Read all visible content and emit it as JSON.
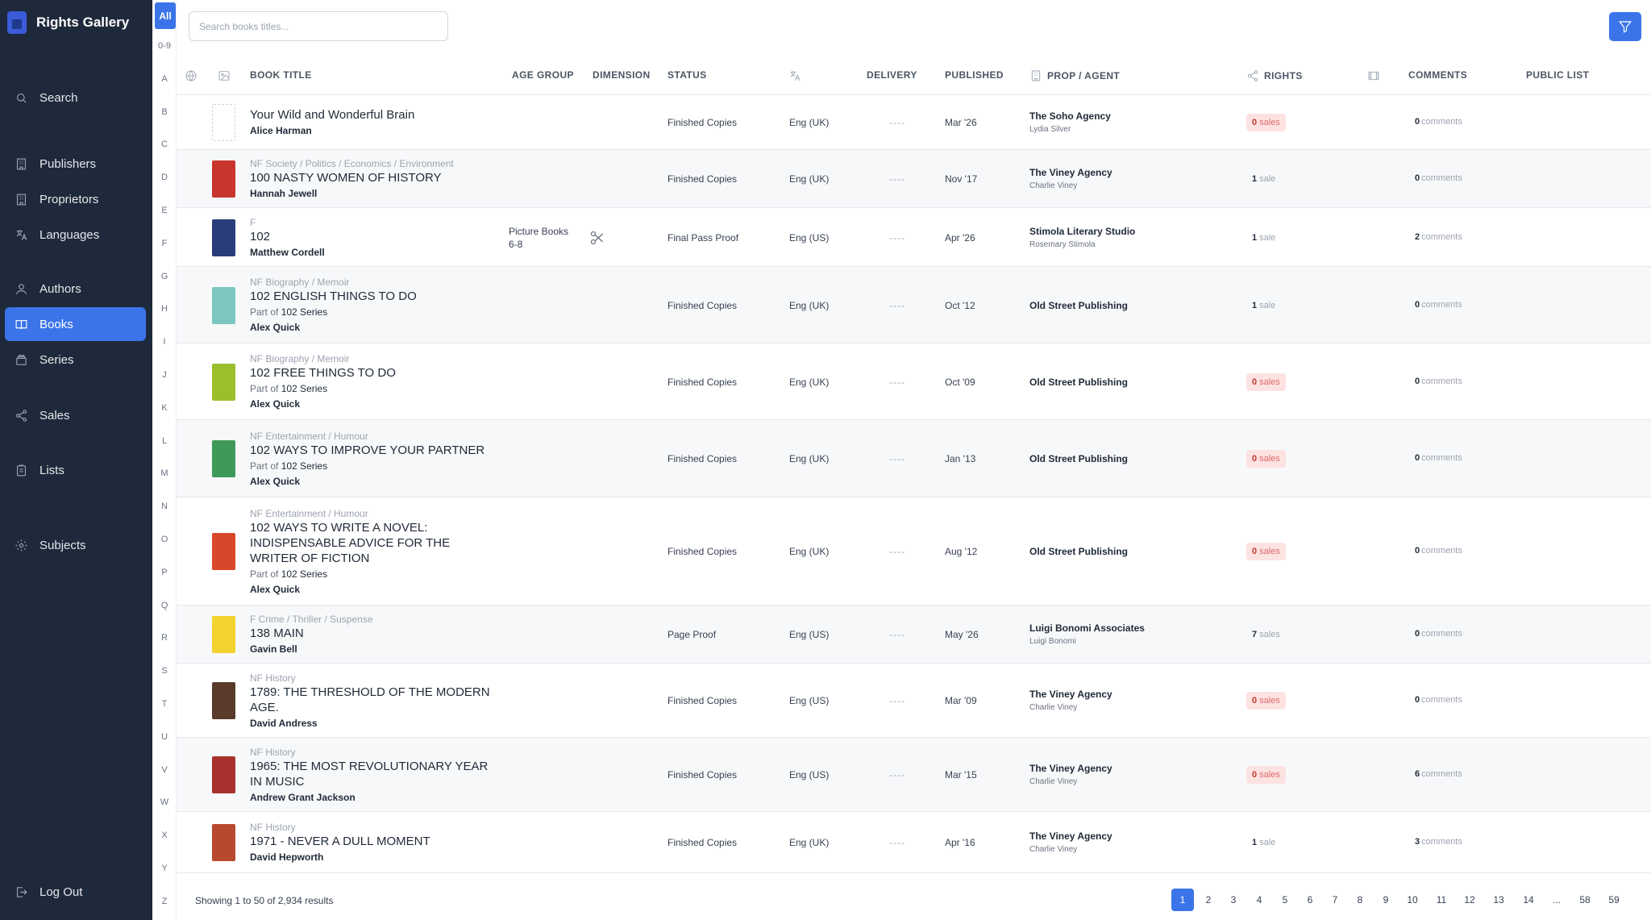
{
  "brand": {
    "name": "Rights Gallery"
  },
  "nav": [
    {
      "label": "Search",
      "icon": "search-icon",
      "key": "search"
    },
    {
      "label": "Publishers",
      "icon": "building-icon",
      "key": "publishers"
    },
    {
      "label": "Proprietors",
      "icon": "building-icon",
      "key": "proprietors"
    },
    {
      "label": "Languages",
      "icon": "translate-icon",
      "key": "languages"
    },
    {
      "label": "Authors",
      "icon": "user-icon",
      "key": "authors"
    },
    {
      "label": "Books",
      "icon": "book-open-icon",
      "key": "books",
      "active": true
    },
    {
      "label": "Series",
      "icon": "stack-icon",
      "key": "series"
    },
    {
      "label": "Sales",
      "icon": "share-icon",
      "key": "sales"
    },
    {
      "label": "Lists",
      "icon": "clipboard-icon",
      "key": "lists"
    },
    {
      "label": "Subjects",
      "icon": "gear-icon",
      "key": "subjects"
    },
    {
      "label": "Log Out",
      "icon": "logout-icon",
      "key": "logout"
    }
  ],
  "alphabet": {
    "all": "All",
    "items": [
      "0-9",
      "A",
      "B",
      "C",
      "D",
      "E",
      "F",
      "G",
      "H",
      "I",
      "J",
      "K",
      "L",
      "M",
      "N",
      "O",
      "P",
      "Q",
      "R",
      "S",
      "T",
      "U",
      "V",
      "W",
      "X",
      "Y",
      "Z"
    ]
  },
  "search": {
    "placeholder": "Search books titles..."
  },
  "columns": {
    "title": "BOOK TITLE",
    "age": "AGE GROUP",
    "dimension": "DIMENSION",
    "status": "STATUS",
    "delivery": "DELIVERY",
    "published": "PUBLISHED",
    "agent": "PROP / AGENT",
    "rights": "RIGHTS",
    "comments": "COMMENTS",
    "public_list": "PUBLIC LIST"
  },
  "series_prefix": "Part of",
  "rows": [
    {
      "category": "",
      "title": "Your Wild and Wonderful Brain",
      "series": "",
      "author": "Alice Harman",
      "age": "",
      "dimension": "",
      "status": "Finished Copies",
      "language": "Eng (UK)",
      "delivery": "----",
      "published": "Mar '26",
      "agent": "The Soho Agency",
      "agent_person": "Lydia Silver",
      "rights_count": "0",
      "rights_label": "sales",
      "comments_count": "0",
      "comments_label": "comments",
      "cover": "none"
    },
    {
      "category": "NF Society / Politics / Economics / Environment",
      "title": "100 NASTY WOMEN OF HISTORY",
      "series": "",
      "author": "Hannah Jewell",
      "age": "",
      "dimension": "",
      "status": "Finished Copies",
      "language": "Eng (UK)",
      "delivery": "----",
      "published": "Nov '17",
      "agent": "The Viney Agency",
      "agent_person": "Charlie Viney",
      "rights_count": "1",
      "rights_label": "sale",
      "comments_count": "0",
      "comments_label": "comments",
      "cover": "#c8352e"
    },
    {
      "category": "F",
      "title": "102",
      "series": "",
      "author": "Matthew Cordell",
      "age": "Picture Books 6-8",
      "dimension": "scissors-icon",
      "status": "Final Pass Proof",
      "language": "Eng (US)",
      "delivery": "----",
      "published": "Apr '26",
      "agent": "Stimola Literary Studio",
      "agent_person": "Rosemary Stimola",
      "rights_count": "1",
      "rights_label": "sale",
      "comments_count": "2",
      "comments_label": "comments",
      "cover": "#2a3d7a"
    },
    {
      "category": "NF Biography / Memoir",
      "title": "102 ENGLISH THINGS TO DO",
      "series": "102 Series",
      "author": "Alex Quick",
      "age": "",
      "dimension": "",
      "status": "Finished Copies",
      "language": "Eng (UK)",
      "delivery": "----",
      "published": "Oct '12",
      "agent": "Old Street Publishing",
      "agent_person": "",
      "rights_count": "1",
      "rights_label": "sale",
      "comments_count": "0",
      "comments_label": "comments",
      "cover": "#7cc7c0"
    },
    {
      "category": "NF Biography / Memoir",
      "title": "102 FREE THINGS TO DO",
      "series": "102 Series",
      "author": "Alex Quick",
      "age": "",
      "dimension": "",
      "status": "Finished Copies",
      "language": "Eng (UK)",
      "delivery": "----",
      "published": "Oct '09",
      "agent": "Old Street Publishing",
      "agent_person": "",
      "rights_count": "0",
      "rights_label": "sales",
      "comments_count": "0",
      "comments_label": "comments",
      "cover": "#9bbf2c"
    },
    {
      "category": "NF Entertainment / Humour",
      "title": "102 WAYS TO IMPROVE YOUR PARTNER",
      "series": "102 Series",
      "author": "Alex Quick",
      "age": "",
      "dimension": "",
      "status": "Finished Copies",
      "language": "Eng (UK)",
      "delivery": "----",
      "published": "Jan '13",
      "agent": "Old Street Publishing",
      "agent_person": "",
      "rights_count": "0",
      "rights_label": "sales",
      "comments_count": "0",
      "comments_label": "comments",
      "cover": "#3f9a5a"
    },
    {
      "category": "NF Entertainment / Humour",
      "title": "102 WAYS TO WRITE A NOVEL: INDISPENSABLE ADVICE FOR THE WRITER OF FICTION",
      "series": "102 Series",
      "author": "Alex Quick",
      "age": "",
      "dimension": "",
      "status": "Finished Copies",
      "language": "Eng (UK)",
      "delivery": "----",
      "published": "Aug '12",
      "agent": "Old Street Publishing",
      "agent_person": "",
      "rights_count": "0",
      "rights_label": "sales",
      "comments_count": "0",
      "comments_label": "comments",
      "cover": "#d9472b"
    },
    {
      "category": "F Crime / Thriller / Suspense",
      "title": "138 MAIN",
      "series": "",
      "author": "Gavin Bell",
      "age": "",
      "dimension": "",
      "status": "Page Proof",
      "language": "Eng (US)",
      "delivery": "----",
      "published": "May '26",
      "agent": "Luigi Bonomi Associates",
      "agent_person": "Luigi Bonomi",
      "rights_count": "7",
      "rights_label": "sales",
      "comments_count": "0",
      "comments_label": "comments",
      "cover": "#f2d22e"
    },
    {
      "category": "NF History",
      "title": "1789: THE THRESHOLD OF THE MODERN AGE.",
      "series": "",
      "author": "David Andress",
      "age": "",
      "dimension": "",
      "status": "Finished Copies",
      "language": "Eng (US)",
      "delivery": "----",
      "published": "Mar '09",
      "agent": "The Viney Agency",
      "agent_person": "Charlie Viney",
      "rights_count": "0",
      "rights_label": "sales",
      "comments_count": "0",
      "comments_label": "comments",
      "cover": "#5a3a2a"
    },
    {
      "category": "NF History",
      "title": "1965: THE MOST REVOLUTIONARY YEAR IN MUSIC",
      "series": "",
      "author": "Andrew Grant Jackson",
      "age": "",
      "dimension": "",
      "status": "Finished Copies",
      "language": "Eng (US)",
      "delivery": "----",
      "published": "Mar '15",
      "agent": "The Viney Agency",
      "agent_person": "Charlie Viney",
      "rights_count": "0",
      "rights_label": "sales",
      "comments_count": "6",
      "comments_label": "comments",
      "cover": "#a8322e"
    },
    {
      "category": "NF History",
      "title": "1971 - NEVER A DULL MOMENT",
      "series": "",
      "author": "David Hepworth",
      "age": "",
      "dimension": "",
      "status": "Finished Copies",
      "language": "Eng (UK)",
      "delivery": "----",
      "published": "Apr '16",
      "agent": "The Viney Agency",
      "agent_person": "Charlie Viney",
      "rights_count": "1",
      "rights_label": "sale",
      "comments_count": "3",
      "comments_label": "comments",
      "cover": "#b8482e"
    }
  ],
  "footer": {
    "showing": "Showing 1 to 50 of 2,934 results",
    "pages": [
      "1",
      "2",
      "3",
      "4",
      "5",
      "6",
      "7",
      "8",
      "9",
      "10",
      "11",
      "12",
      "13",
      "14",
      "...",
      "58",
      "59"
    ],
    "current_page": "1"
  }
}
